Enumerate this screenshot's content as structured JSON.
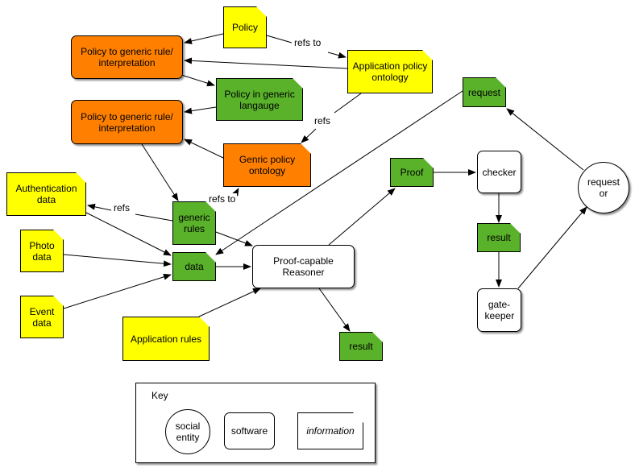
{
  "colors": {
    "information_yellow": "#ffff00",
    "information_green": "#5ab12a",
    "orange": "#ff8000",
    "software": "#ffffff",
    "edge": "#000000"
  },
  "nodes": {
    "policy": {
      "label": "Policy",
      "type": "information"
    },
    "policy_to_generic_1": {
      "label": "Policy to generic rule/ interpretation",
      "type": "software"
    },
    "app_policy_ontology": {
      "label": "Application policy ontology",
      "type": "information"
    },
    "policy_in_generic": {
      "label": "Policy in generic langauge",
      "type": "information"
    },
    "policy_to_generic_2": {
      "label": "Policy to generic rule/ interpretation",
      "type": "software"
    },
    "genric_policy_ontology": {
      "label": "Genric policy ontology",
      "type": "information"
    },
    "request": {
      "label": "request",
      "type": "information"
    },
    "auth_data": {
      "label": "Authentication data",
      "type": "information"
    },
    "photo_data": {
      "label": "Photo data",
      "type": "information"
    },
    "event_data": {
      "label": "Event data",
      "type": "information"
    },
    "generic_rules": {
      "label": "generic rules",
      "type": "information"
    },
    "data": {
      "label": "data",
      "type": "information"
    },
    "reasoner": {
      "label": "Proof-capable Reasoner",
      "type": "software"
    },
    "proof": {
      "label": "Proof",
      "type": "information"
    },
    "checker": {
      "label": "checker",
      "type": "software"
    },
    "result_right": {
      "label": "result",
      "type": "information"
    },
    "gatekeeper": {
      "label": "gate- keeper",
      "type": "software"
    },
    "requestor": {
      "label": "request or",
      "type": "social entity"
    },
    "result_bottom": {
      "label": "result",
      "type": "information"
    },
    "app_rules": {
      "label": "Application rules",
      "type": "information"
    }
  },
  "edge_labels": {
    "refs_to_top": "refs to",
    "refs_mid": "refs",
    "refs_to_mid": "refs to",
    "refs_left": "refs"
  },
  "key": {
    "title": "Key",
    "social_entity": "social entity",
    "software": "software",
    "information": "information"
  }
}
